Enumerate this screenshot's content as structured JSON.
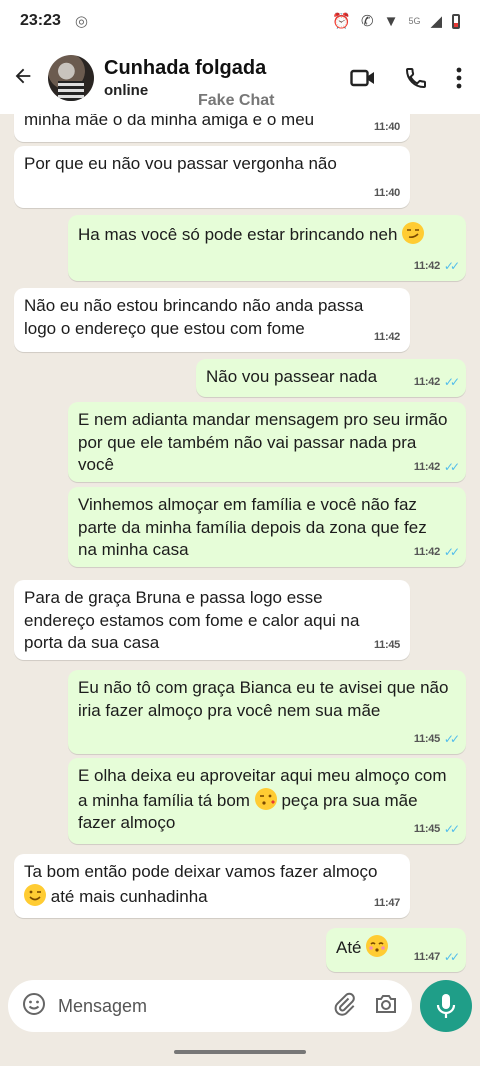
{
  "status_bar": {
    "time": "23:23",
    "network": "5G"
  },
  "header": {
    "contact_name": "Cunhada folgada",
    "contact_status": "online",
    "watermark": "Fake Chat"
  },
  "messages": [
    {
      "dir": "in",
      "text": "minha mãe o da minha amiga e o meu",
      "time": "11:40",
      "emoji": ""
    },
    {
      "dir": "in",
      "text": "Por que eu não vou passar vergonha não",
      "time": "11:40",
      "emoji": ""
    },
    {
      "dir": "out",
      "text": "Ha mas você só pode estar brincando neh",
      "time": "11:42",
      "emoji": "smirking-face"
    },
    {
      "dir": "in",
      "text": "Não eu não estou brincando não anda passa logo o endereço que estou com fome",
      "time": "11:42",
      "emoji": ""
    },
    {
      "dir": "out",
      "text": "Não vou passear nada",
      "time": "11:42",
      "emoji": ""
    },
    {
      "dir": "out",
      "text": "E nem adianta mandar mensagem pro seu irmão por que ele também não vai passar nada pra você",
      "time": "11:42",
      "emoji": ""
    },
    {
      "dir": "out",
      "text": "Vinhemos almoçar em família e você não faz parte da minha família depois da zona que fez na minha casa",
      "time": "11:42",
      "emoji": ""
    },
    {
      "dir": "in",
      "text": "Para de graça Bruna e passa logo esse endereço estamos com fome e calor aqui na porta da sua casa",
      "time": "11:45",
      "emoji": ""
    },
    {
      "dir": "out",
      "text": "Eu não tô com graça Bianca eu te avisei que não iria fazer almoço pra você nem sua mãe",
      "time": "11:45",
      "emoji": ""
    },
    {
      "dir": "out",
      "text_before": "E olha deixa eu aproveitar aqui meu almoço com a minha família tá bom",
      "text_after": "peça pra sua mãe fazer almoço",
      "time": "11:45",
      "emoji": "face-blowing-kiss"
    },
    {
      "dir": "in",
      "text_before": "Ta bom então pode deixar vamos fazer almoço",
      "text_after": "até mais cunhadinha",
      "time": "11:47",
      "emoji": "winking-face"
    },
    {
      "dir": "out",
      "text": "Até",
      "time": "11:47",
      "emoji": "kissing-face-closed-eyes"
    }
  ],
  "composer": {
    "placeholder": "Mensagem"
  },
  "colors": {
    "incoming": "#ffffff",
    "outgoing": "#e6fdd8",
    "read_ticks": "#53bdeb",
    "mic": "#1f9e88",
    "background": "#efeae2"
  }
}
